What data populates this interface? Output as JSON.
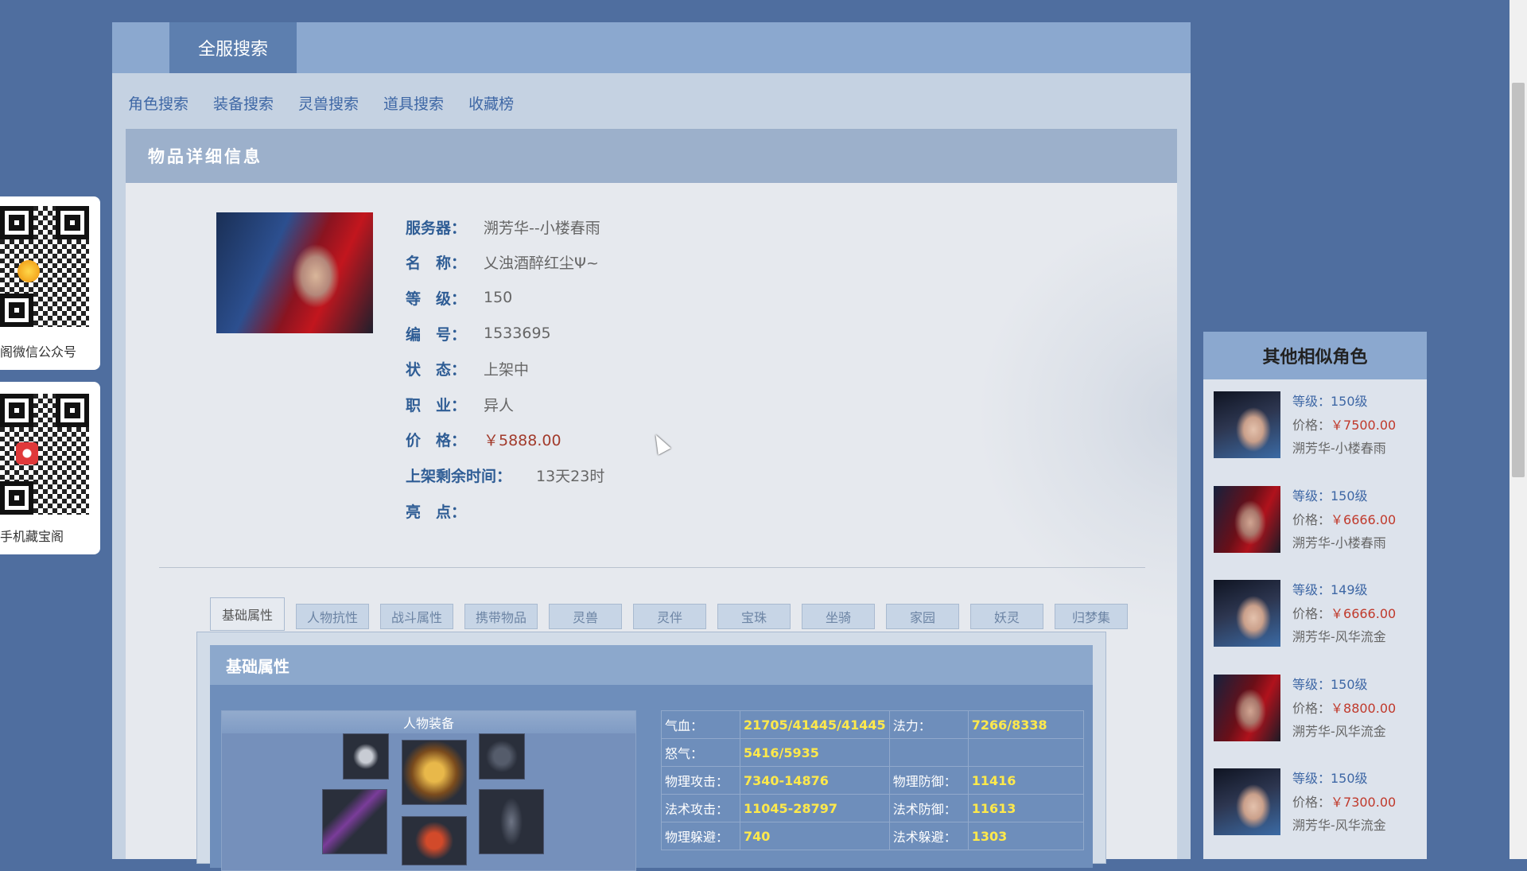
{
  "top_tab": "全服搜索",
  "subnav": [
    "角色搜索",
    "装备搜索",
    "灵兽搜索",
    "道具搜索",
    "收藏榜"
  ],
  "detail": {
    "header": "物品详细信息",
    "fields": [
      {
        "label": "服务器：",
        "value": "溯芳华--小楼春雨"
      },
      {
        "label": "名　称：",
        "value": "乂浊酒醉红尘Ψ~"
      },
      {
        "label": "等　级：",
        "value": "150"
      },
      {
        "label": "编　号：",
        "value": "1533695"
      },
      {
        "label": "状　态：",
        "value": "上架中"
      },
      {
        "label": "职　业：",
        "value": "异人"
      },
      {
        "label": "价　格：",
        "value": "￥5888.00"
      },
      {
        "label": "上架剩余时间：",
        "value": "13天23时"
      },
      {
        "label": "亮　点：",
        "value": ""
      }
    ]
  },
  "attr_tabs": [
    "基础属性",
    "人物抗性",
    "战斗属性",
    "携带物品",
    "灵兽",
    "灵伴",
    "宝珠",
    "坐骑",
    "家园",
    "妖灵",
    "归梦集"
  ],
  "attr_panel": {
    "title": "基础属性",
    "equip_title": "人物装备",
    "stats": [
      {
        "k1": "气血：",
        "v1": "21705/41445/41445",
        "k2": "法力：",
        "v2": "7266/8338"
      },
      {
        "k1": "怒气：",
        "v1": "5416/5935",
        "k2": "",
        "v2": ""
      },
      {
        "k1": "物理攻击：",
        "v1": "7340-14876",
        "k2": "物理防御：",
        "v2": "11416"
      },
      {
        "k1": "法术攻击：",
        "v1": "11045-28797",
        "k2": "法术防御：",
        "v2": "11613"
      },
      {
        "k1": "物理躲避：",
        "v1": "740",
        "k2": "法术躲避：",
        "v2": "1303"
      }
    ]
  },
  "qr": {
    "wechat_caption": "阁微信公众号",
    "mobile_caption": "手机藏宝阁"
  },
  "similar": {
    "title": "其他相似角色",
    "items": [
      {
        "level": "等级：150级",
        "price_label": "价格：",
        "price": "￥7500.00",
        "server": "溯芳华-小楼春雨",
        "avatar": "female"
      },
      {
        "level": "等级：150级",
        "price_label": "价格：",
        "price": "￥6666.00",
        "server": "溯芳华-小楼春雨",
        "avatar": "male"
      },
      {
        "level": "等级：149级",
        "price_label": "价格：",
        "price": "￥6666.00",
        "server": "溯芳华-风华流金",
        "avatar": "female"
      },
      {
        "level": "等级：150级",
        "price_label": "价格：",
        "price": "￥8800.00",
        "server": "溯芳华-风华流金",
        "avatar": "male"
      },
      {
        "level": "等级：150级",
        "price_label": "价格：",
        "price": "￥7300.00",
        "server": "溯芳华-风华流金",
        "avatar": "female"
      }
    ]
  },
  "colors": {
    "accent": "#3e67a5",
    "price": "#a23b2c",
    "stat_value": "#ffe94b",
    "page_bg": "#4f6e9f"
  }
}
